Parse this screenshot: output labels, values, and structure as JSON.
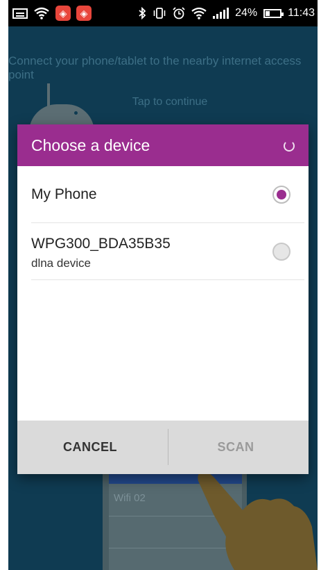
{
  "status_bar": {
    "battery_percent": "24%",
    "time": "11:43",
    "icons": [
      "message-icon",
      "wifi-icon",
      "app-icon",
      "app-icon",
      "bluetooth-icon",
      "vibrate-icon",
      "alarm-icon",
      "wifi-icon",
      "signal-icon",
      "battery-icon"
    ]
  },
  "background": {
    "instruction": "Connect your phone/tablet to the nearby internet access point",
    "tap_hint": "Tap to continue",
    "wifi_item": "Wifi 02"
  },
  "dialog": {
    "title": "Choose a device",
    "devices": [
      {
        "name": "My Phone",
        "subtitle": "",
        "selected": true
      },
      {
        "name": "WPG300_BDA35B35",
        "subtitle": "dlna device",
        "selected": false
      }
    ],
    "cancel_label": "CANCEL",
    "scan_label": "SCAN"
  },
  "colors": {
    "accent": "#9a2d8f",
    "background": "#0f3b52"
  }
}
